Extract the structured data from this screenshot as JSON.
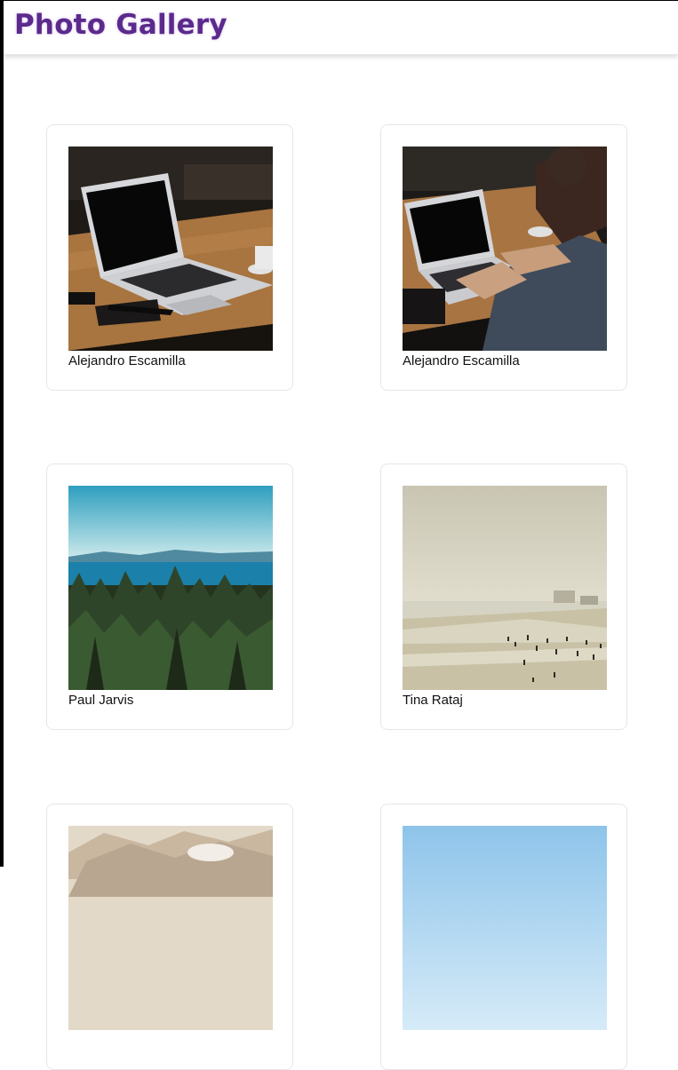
{
  "header": {
    "title": "Photo Gallery"
  },
  "gallery": {
    "items": [
      {
        "author": "Alejandro Escamilla",
        "image": "laptop-on-wooden-table"
      },
      {
        "author": "Alejandro Escamilla",
        "image": "person-typing-on-laptop"
      },
      {
        "author": "Paul Jarvis",
        "image": "forest-and-sea"
      },
      {
        "author": "Tina Rataj",
        "image": "hazy-beach"
      },
      {
        "author": "",
        "image": "misty-mountains"
      },
      {
        "author": "",
        "image": "blue-sky"
      }
    ]
  },
  "colors": {
    "title": "#5b2a8c",
    "card_border": "#e6e6e6"
  }
}
